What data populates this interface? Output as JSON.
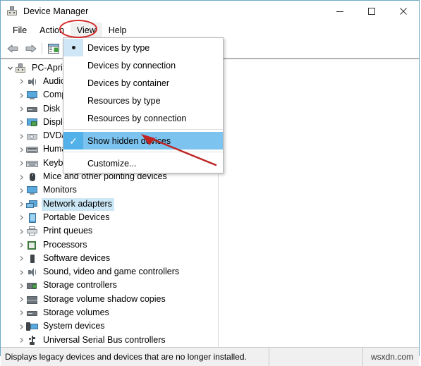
{
  "window": {
    "title": "Device Manager",
    "icon": "device-manager-icon",
    "controls": {
      "minimize": "minimize-icon",
      "maximize": "maximize-icon",
      "close": "close-icon"
    }
  },
  "menubar": {
    "items": [
      {
        "label": "File",
        "name": "menu-file"
      },
      {
        "label": "Action",
        "name": "menu-action"
      },
      {
        "label": "View",
        "name": "menu-view"
      },
      {
        "label": "Help",
        "name": "menu-help"
      }
    ]
  },
  "toolbar": {
    "buttons": [
      {
        "name": "back-arrow-icon",
        "icon": "arrow-left"
      },
      {
        "name": "forward-arrow-icon",
        "icon": "arrow-right"
      },
      {
        "name": "show-console-tree-icon",
        "icon": "window-panel"
      }
    ]
  },
  "view_menu": {
    "open": true,
    "items": [
      {
        "label": "Devices by type",
        "state": "radio-selected",
        "name": "menu-item-devices-by-type"
      },
      {
        "label": "Devices by connection",
        "state": "none",
        "name": "menu-item-devices-by-connection"
      },
      {
        "label": "Devices by container",
        "state": "none",
        "name": "menu-item-devices-by-container"
      },
      {
        "label": "Resources by type",
        "state": "none",
        "name": "menu-item-resources-by-type"
      },
      {
        "label": "Resources by connection",
        "state": "none",
        "name": "menu-item-resources-by-connection"
      },
      {
        "label": "Show hidden devices",
        "state": "checked",
        "name": "menu-item-show-hidden-devices"
      },
      {
        "label": "Customize...",
        "state": "none",
        "name": "menu-item-customize"
      }
    ],
    "separator_after_indices": [
      4,
      5
    ]
  },
  "tree": {
    "root": {
      "label": "PC-Apri",
      "expanded": true,
      "icon": "computer-icon"
    },
    "items": [
      {
        "label": "Audio inputs and outputs",
        "icon": "speaker-icon",
        "selected": false
      },
      {
        "label": "Computer",
        "icon": "monitor-icon",
        "selected": false
      },
      {
        "label": "Disk drives",
        "icon": "disk-drive-icon",
        "selected": false
      },
      {
        "label": "Display adapters",
        "icon": "display-adapter-icon",
        "selected": false
      },
      {
        "label": "DVD/CD-ROM drives",
        "icon": "dvd-drive-icon",
        "selected": false
      },
      {
        "label": "Human Interface Devices",
        "icon": "hid-icon",
        "selected": false
      },
      {
        "label": "Keyboards",
        "icon": "keyboard-icon",
        "selected": false
      },
      {
        "label": "Mice and other pointing devices",
        "icon": "mouse-icon",
        "selected": false
      },
      {
        "label": "Monitors",
        "icon": "monitor-icon",
        "selected": false
      },
      {
        "label": "Network adapters",
        "icon": "network-adapter-icon",
        "selected": true
      },
      {
        "label": "Portable Devices",
        "icon": "portable-device-icon",
        "selected": false
      },
      {
        "label": "Print queues",
        "icon": "printer-icon",
        "selected": false
      },
      {
        "label": "Processors",
        "icon": "processor-icon",
        "selected": false
      },
      {
        "label": "Software devices",
        "icon": "software-device-icon",
        "selected": false
      },
      {
        "label": "Sound, video and game controllers",
        "icon": "speaker-icon",
        "selected": false
      },
      {
        "label": "Storage controllers",
        "icon": "storage-controller-icon",
        "selected": false
      },
      {
        "label": "Storage volume shadow copies",
        "icon": "storage-shadow-icon",
        "selected": false
      },
      {
        "label": "Storage volumes",
        "icon": "disk-drive-icon",
        "selected": false
      },
      {
        "label": "System devices",
        "icon": "system-device-icon",
        "selected": false
      },
      {
        "label": "Universal Serial Bus controllers",
        "icon": "usb-icon",
        "selected": false
      }
    ]
  },
  "statusbar": {
    "message": "Displays legacy devices and devices that are no longer installed.",
    "middle": "",
    "watermark": "wsxdn.com"
  },
  "annotations": {
    "ellipse_target": "View",
    "arrow_target": "Show hidden devices",
    "color": "#d42b2b"
  }
}
